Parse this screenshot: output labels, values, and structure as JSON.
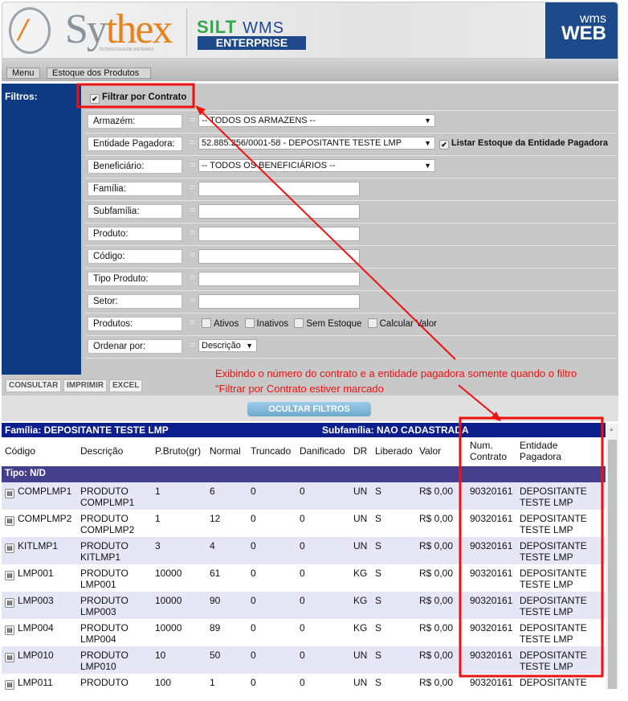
{
  "header": {
    "brand": "Sythex",
    "brand_sub": "TECNOLOGIA EM SISTEMAS",
    "product": "SILT",
    "product_suffix": "WMS",
    "edition": "ENTERPRISE",
    "badge_top": "wms",
    "badge_bottom": "WEB"
  },
  "breadcrumb": [
    "Menu",
    "Estoque dos Produtos"
  ],
  "filters": {
    "title": "Filtros:",
    "filtrar_contrato": {
      "label": "Filtrar por Contrato",
      "checked": true
    },
    "armazem": {
      "label": "Armazém:",
      "value": "-- TODOS OS ARMAZENS --"
    },
    "entidade": {
      "label": "Entidade Pagadora:",
      "value": "52.885.256/0001-58 - DEPOSITANTE TESTE LMP",
      "listar_label": "Listar Estoque da Entidade Pagadora",
      "listar_checked": true
    },
    "beneficiario": {
      "label": "Beneficiário:",
      "value": "-- TODOS OS BENEFICIÁRIOS --"
    },
    "familia": {
      "label": "Família:",
      "value": ""
    },
    "subfamilia": {
      "label": "Subfamília:",
      "value": ""
    },
    "produto": {
      "label": "Produto:",
      "value": ""
    },
    "codigo": {
      "label": "Código:",
      "value": ""
    },
    "tipo_produto": {
      "label": "Tipo Produto:",
      "value": ""
    },
    "setor": {
      "label": "Setor:",
      "value": ""
    },
    "produtos": {
      "label": "Produtos:",
      "options": [
        "Ativos",
        "Inativos",
        "Sem Estoque",
        "Calcular Valor"
      ]
    },
    "ordenar": {
      "label": "Ordenar por:",
      "value": "Descrição"
    },
    "equals": "="
  },
  "buttons": {
    "consultar": "CONSULTAR",
    "imprimir": "IMPRIMIR",
    "excel": "EXCEL",
    "ocultar": "OCULTAR FILTROS"
  },
  "annotation": {
    "line1": "Exibindo o número do contrato e a entidade pagadora somente quando o filtro",
    "line2": "\"Filtrar por Contrato estiver marcado",
    "color": "#f01010"
  },
  "table": {
    "familia": "Família: DEPOSITANTE TESTE LMP",
    "subfamilia": "Subfamília: NAO CADASTRADA",
    "columns": [
      "Código",
      "Descrição",
      "P.Bruto(gr)",
      "Normal",
      "Truncado",
      "Danificado",
      "DR",
      "Liberado",
      "Valor",
      "Num. Contrato",
      "Entidade Pagadora"
    ],
    "tipo": "Tipo: N/D",
    "rows": [
      [
        "COMPLMP1",
        "PRODUTO COMPLMP1",
        "1",
        "6",
        "0",
        "0",
        "UN",
        "S",
        "R$ 0,00",
        "90320161",
        "DEPOSITANTE TESTE LMP"
      ],
      [
        "COMPLMP2",
        "PRODUTO COMPLMP2",
        "1",
        "12",
        "0",
        "0",
        "UN",
        "S",
        "R$ 0,00",
        "90320161",
        "DEPOSITANTE TESTE LMP"
      ],
      [
        "KITLMP1",
        "PRODUTO KITLMP1",
        "3",
        "4",
        "0",
        "0",
        "UN",
        "S",
        "R$ 0,00",
        "90320161",
        "DEPOSITANTE TESTE LMP"
      ],
      [
        "LMP001",
        "PRODUTO LMP001",
        "10000",
        "61",
        "0",
        "0",
        "KG",
        "S",
        "R$ 0,00",
        "90320161",
        "DEPOSITANTE TESTE LMP"
      ],
      [
        "LMP003",
        "PRODUTO LMP003",
        "10000",
        "90",
        "0",
        "0",
        "KG",
        "S",
        "R$ 0,00",
        "90320161",
        "DEPOSITANTE TESTE LMP"
      ],
      [
        "LMP004",
        "PRODUTO LMP004",
        "10000",
        "89",
        "0",
        "0",
        "KG",
        "S",
        "R$ 0,00",
        "90320161",
        "DEPOSITANTE TESTE LMP"
      ],
      [
        "LMP010",
        "PRODUTO LMP010",
        "10",
        "50",
        "0",
        "0",
        "UN",
        "S",
        "R$ 0,00",
        "90320161",
        "DEPOSITANTE TESTE LMP"
      ],
      [
        "LMP011",
        "PRODUTO",
        "100",
        "1",
        "0",
        "0",
        "UN",
        "S",
        "R$ 0,00",
        "90320161",
        "DEPOSITANTE"
      ]
    ]
  }
}
